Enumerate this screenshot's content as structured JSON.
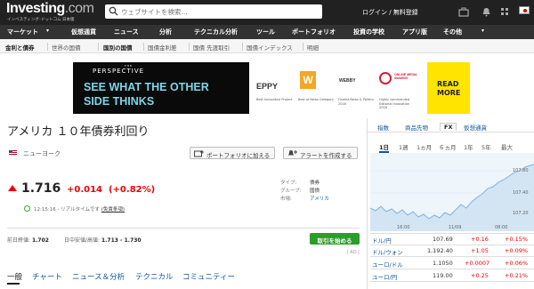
{
  "header": {
    "logo_main": "Investing",
    "logo_dot": ".com",
    "logo_sub": "インベスティング･ドットコム 日本版",
    "search_placeholder": "ウェブサイトを検索...",
    "login": "ログイン / 無料登録"
  },
  "nav": [
    "マーケット",
    "仮想通貨",
    "ニュース",
    "分析",
    "テクニカル分析",
    "ツール",
    "ポートフォリオ",
    "投資の学校",
    "アプリ版",
    "その他"
  ],
  "subnav": [
    "金利と債券",
    "世界の国債",
    "国別の国債",
    "国債金利差",
    "国債 先渡取引",
    "国債インデックス",
    "明細"
  ],
  "ad": {
    "brand": "PERSPECTIVE",
    "line1": "SEE WHAT THE OTHER",
    "line2": "SIDE THINKS",
    "award1_logo": "EPPY",
    "award1_text": "Best Innovative Project",
    "award2_logo": "W",
    "award2_text": "Best of News Category",
    "award3_logo": "WEBBY",
    "award3_text": "Finalist News & Politics 2018",
    "award4_logo": "ONLINE MEDIA AWARDS",
    "award4_text": "Highly commended Editorial Innovation 2018",
    "cta": "READ MORE"
  },
  "instrument": {
    "title": "アメリカ １０年債券利回り",
    "location": "ニューヨーク",
    "add_portfolio": "ポートフォリオに加える",
    "create_alert": "アラートを作成する",
    "price": "1.716",
    "change": "+0.014",
    "change_pct": "(+0.82%)",
    "time": "12:15:16 - リアルタイムです",
    "disclaimer": "(免責条項)",
    "type_label": "タイプ:",
    "type_value": "債券",
    "group_label": "グループ:",
    "group_value": "国債",
    "market_label": "市場:",
    "market_value": "アメリカ",
    "prev_close_label": "前日終値:",
    "prev_close": "1.702",
    "day_range_label": "日中安値/高値:",
    "day_range": "1.713 - 1.730",
    "trade_button": "取引を始める",
    "ad_label": "| AD |",
    "tabs": [
      "一般",
      "チャート",
      "ニュース＆分析",
      "テクニカル",
      "コミュニティー"
    ]
  },
  "side": {
    "tabs": [
      "指数",
      "商品先物",
      "FX",
      "仮想通貨"
    ],
    "timeframes": [
      "1日",
      "1週",
      "1ヵ月",
      "６ヵ月",
      "1年",
      "5年",
      "最大"
    ],
    "axis_y": [
      "107.80",
      "107.40",
      "107.20"
    ],
    "axis_x": [
      "16:00",
      "11/09",
      "08:00"
    ],
    "rows": [
      {
        "name": "ドル/円",
        "price": "107.69",
        "chg": "+0.16",
        "pct": "+0.15%"
      },
      {
        "name": "ドル/ウォン",
        "price": "1,192.40",
        "chg": "+1.05",
        "pct": "+0.09%"
      },
      {
        "name": "ユーロ/ドル",
        "price": "1.1050",
        "chg": "+0.0007",
        "pct": "+0.06%"
      },
      {
        "name": "ユーロ/円",
        "price": "119.00",
        "chg": "+0.25",
        "pct": "+0.21%"
      }
    ]
  }
}
